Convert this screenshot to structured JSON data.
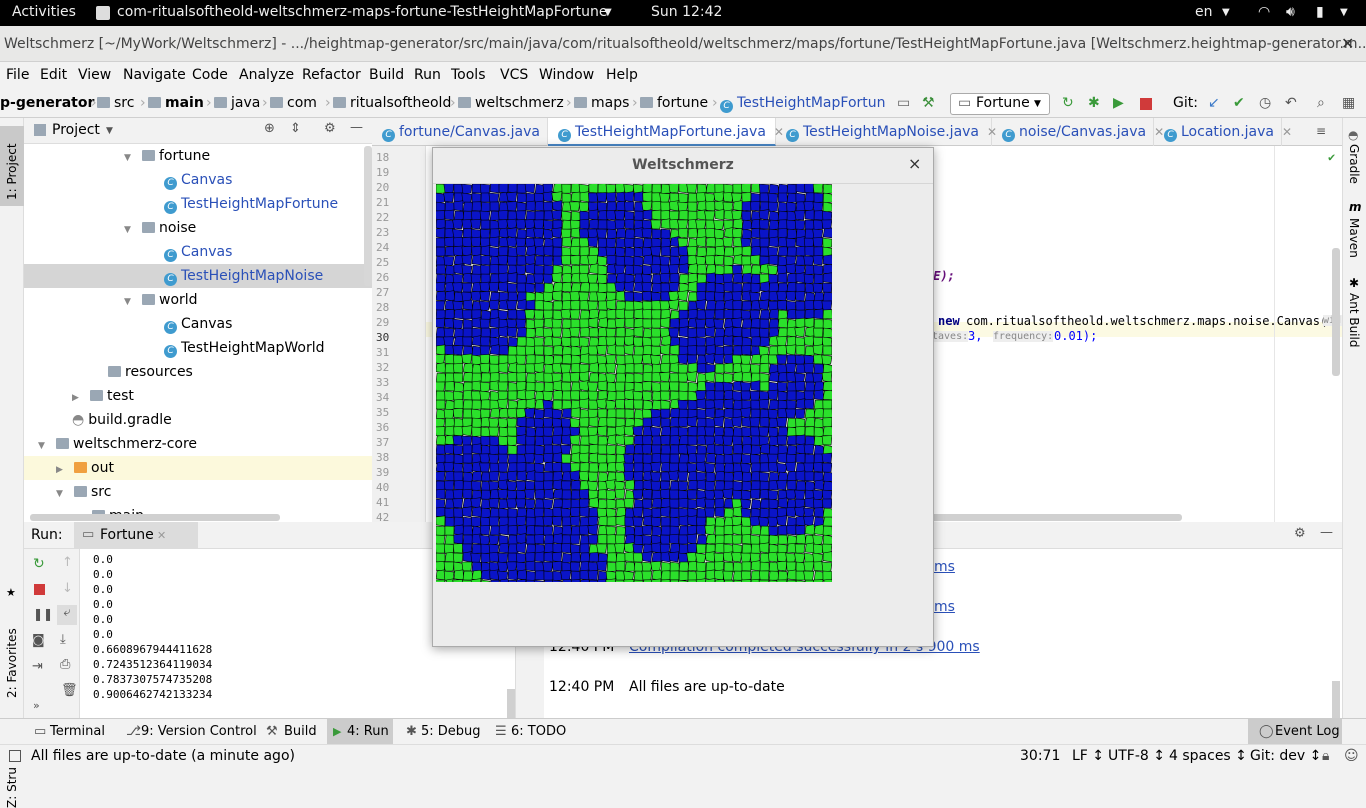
{
  "topbar": {
    "activities": "Activities",
    "app_title": "com-ritualsoftheold-weltschmerz-maps-fortune-TestHeightMapFortune",
    "clock": "Sun 12:42",
    "lang": "en"
  },
  "window_title": "Weltschmerz [~/MyWork/Weltschmerz] - .../heightmap-generator/src/main/java/com/ritualsoftheold/weltschmerz/maps/fortune/TestHeightMapFortune.java [Weltschmerz.heightmap-generator.m...",
  "menu": [
    "File",
    "Edit",
    "View",
    "Navigate",
    "Code",
    "Analyze",
    "Refactor",
    "Build",
    "Run",
    "Tools",
    "VCS",
    "Window",
    "Help"
  ],
  "breadcrumb": [
    "p-generator",
    "src",
    "main",
    "java",
    "com",
    "ritualsoftheold",
    "weltschmerz",
    "maps",
    "fortune",
    "TestHeightMapFortune"
  ],
  "run_config": "Fortune",
  "git_label": "Git:",
  "project_panel": {
    "title": "Project",
    "tree": [
      {
        "label": "fortune",
        "type": "folder",
        "indent": 1
      },
      {
        "label": "Canvas",
        "type": "class",
        "indent": 2
      },
      {
        "label": "TestHeightMapFortune",
        "type": "class",
        "indent": 2
      },
      {
        "label": "noise",
        "type": "folder",
        "indent": 1
      },
      {
        "label": "Canvas",
        "type": "class",
        "indent": 2
      },
      {
        "label": "TestHeightMapNoise",
        "type": "class",
        "indent": 2
      },
      {
        "label": "world",
        "type": "folder",
        "indent": 1
      },
      {
        "label": "Canvas",
        "type": "class",
        "indent": 2
      },
      {
        "label": "TestHeightMapWorld",
        "type": "class",
        "indent": 2
      },
      {
        "label": "resources",
        "type": "folder",
        "indent": 0
      },
      {
        "label": "test",
        "type": "folder",
        "indent": 0
      },
      {
        "label": "build.gradle",
        "type": "file",
        "indent": 0
      },
      {
        "label": "weltschmerz-core",
        "type": "module",
        "indent": -1
      },
      {
        "label": "out",
        "type": "folder",
        "indent": 0
      },
      {
        "label": "src",
        "type": "folder",
        "indent": 0
      },
      {
        "label": "main",
        "type": "folder",
        "indent": 1
      }
    ]
  },
  "editor_tabs": [
    "fortune/Canvas.java",
    "TestHeightMapFortune.java",
    "TestHeightMapNoise.java",
    "noise/Canvas.java",
    "Location.java"
  ],
  "line_numbers": [
    "18",
    "19",
    "20",
    "21",
    "22",
    "23",
    "24",
    "25",
    "26",
    "27",
    "28",
    "29",
    "30",
    "31",
    "32",
    "33",
    "34",
    "35",
    "36",
    "37",
    "38",
    "39",
    "40",
    "41",
    "42"
  ],
  "code": {
    "line26_tail": "SE);",
    "line29_new": "new",
    "line29_rest": "com.ritualsoftheold.weltschmerz.maps.noise.Canvas(",
    "line29_hint": "wid",
    "line30_hint_octaves": "taves:",
    "line30_octaves": "3,",
    "line30_hint_freq": "frequency:",
    "line30_freq": "0.01);"
  },
  "right_strip": [
    "Gradle",
    "Maven",
    "Ant Build"
  ],
  "left_strip": [
    "1: Project",
    "2: Favorites",
    "Z: Structure"
  ],
  "run_panel": {
    "label": "Run:",
    "tab": "Fortune",
    "console": [
      "0.0",
      "0.0",
      "0.0",
      "0.0",
      "0.0",
      "0.0",
      "0.6608967944411628",
      "0.7243512364119034",
      "0.7837307574735208",
      "0.9006462742133234"
    ]
  },
  "event_log": [
    {
      "time": "",
      "msg": "ms"
    },
    {
      "time": "",
      "msg": "ms"
    },
    {
      "time": "12:40 PM",
      "msg": "Compilation completed successfully in 2 s 900 ms"
    },
    {
      "time": "12:40 PM",
      "msg": "All files are up-to-date"
    }
  ],
  "tool_windows": [
    "Terminal",
    "9: Version Control",
    "Build",
    "4: Run",
    "5: Debug",
    "6: TODO"
  ],
  "event_log_button": "Event Log",
  "status": {
    "message": "All files are up-to-date (a minute ago)",
    "position": "30:71",
    "line_sep": "LF ↕",
    "encoding": "UTF-8 ↕",
    "indent": "4 spaces ↕",
    "git": "Git: dev ↕"
  },
  "dialog": {
    "title": "Weltschmerz",
    "close": "×"
  },
  "map_colors": {
    "land": "#2be02b",
    "water": "#0a14c8",
    "edge": "#000000"
  }
}
